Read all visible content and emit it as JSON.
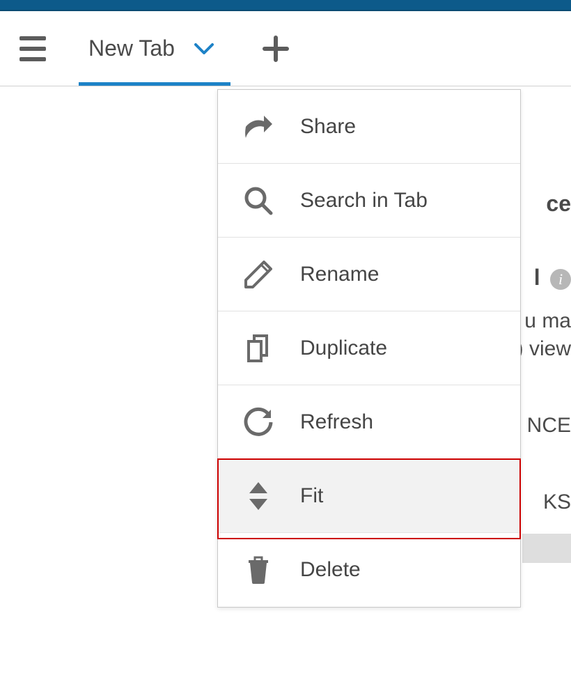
{
  "header": {
    "tab_label": "New Tab"
  },
  "menu": {
    "items": [
      {
        "id": "share",
        "label": "Share",
        "icon": "share-icon"
      },
      {
        "id": "search",
        "label": "Search in Tab",
        "icon": "search-icon"
      },
      {
        "id": "rename",
        "label": "Rename",
        "icon": "pencil-icon"
      },
      {
        "id": "duplicate",
        "label": "Duplicate",
        "icon": "copy-icon"
      },
      {
        "id": "refresh",
        "label": "Refresh",
        "icon": "refresh-icon"
      },
      {
        "id": "fit",
        "label": "Fit",
        "icon": "fit-icon",
        "highlighted": true
      },
      {
        "id": "delete",
        "label": "Delete",
        "icon": "trash-icon"
      }
    ]
  },
  "background": {
    "ce": "ce",
    "ol_suffix": "l",
    "u_ma": "u ma",
    "view": ") view",
    "nce": "NCE",
    "ks": "KS"
  }
}
